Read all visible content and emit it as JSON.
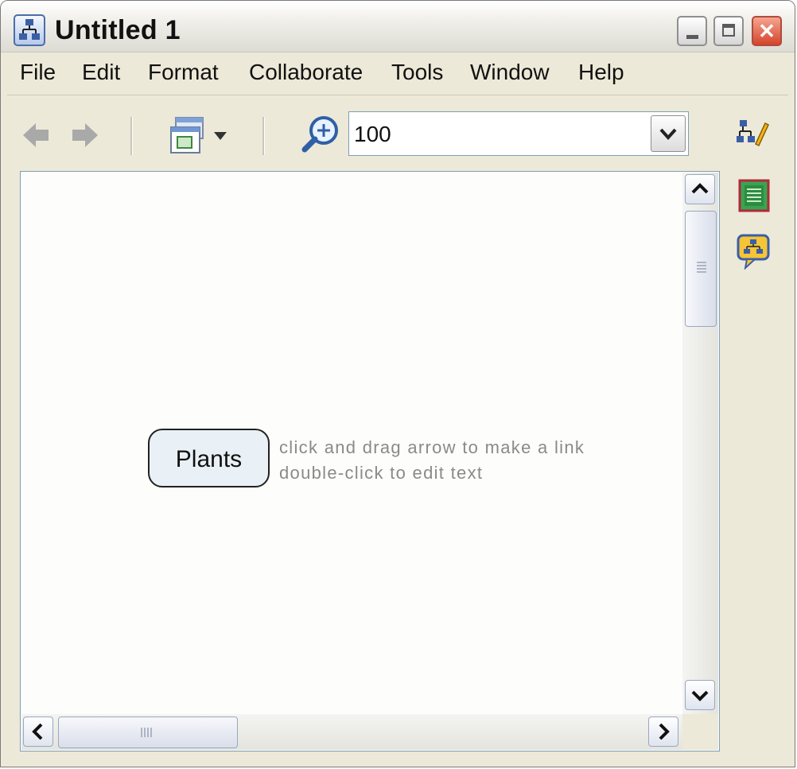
{
  "window": {
    "title": "Untitled 1",
    "buttons": {
      "minimize": "minimize",
      "maximize": "maximize",
      "close": "✕"
    }
  },
  "menu": {
    "items": [
      {
        "label": "File"
      },
      {
        "label": "Edit"
      },
      {
        "label": "Format"
      },
      {
        "label": "Collaborate"
      },
      {
        "label": "Tools"
      },
      {
        "label": "Window"
      },
      {
        "label": "Help"
      }
    ]
  },
  "toolbar": {
    "back_icon": "back-arrow-icon",
    "forward_icon": "forward-arrow-icon",
    "view_menu_icon": "view-windows-icon",
    "zoom_icon": "zoom-in-icon",
    "zoom_value": "100"
  },
  "canvas": {
    "concept_label": "Plants",
    "hint_line1": "click and drag arrow to make a link",
    "hint_line2": "double-click to edit text"
  },
  "side_panel": {
    "icons": [
      "styles-icon",
      "info-icon",
      "collaboration-icon"
    ]
  },
  "colors": {
    "window_bg": "#ece9d8",
    "canvas_bg": "#fdfdfb",
    "concept_fill": "#e9f1f6",
    "hint_text": "#8a8a8a",
    "close_button": "#d4452c"
  }
}
